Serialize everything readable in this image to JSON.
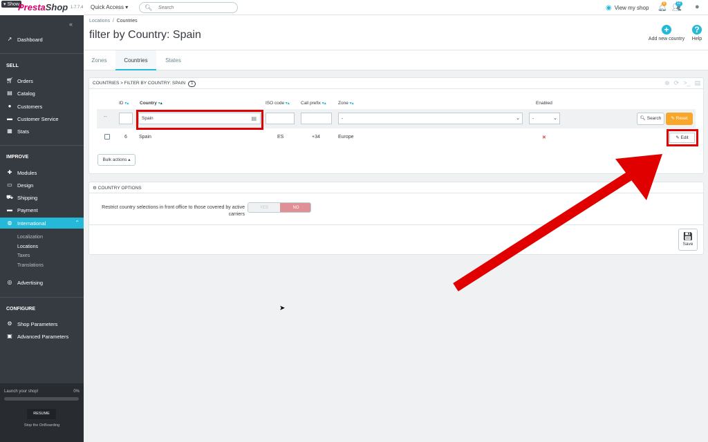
{
  "header": {
    "show_label": "Show",
    "logo_a": "Presta",
    "logo_b": "Shop",
    "version": "1.7.7.4",
    "quick_access": "Quick Access ▾",
    "search_placeholder": "Search",
    "view_shop": "View my shop",
    "notif_orders": "9",
    "notif_customers": "12"
  },
  "sidebar": {
    "dashboard": "Dashboard",
    "sec_sell": "SELL",
    "sell": [
      "Orders",
      "Catalog",
      "Customers",
      "Customer Service",
      "Stats"
    ],
    "sec_improve": "IMPROVE",
    "improve": [
      "Modules",
      "Design",
      "Shipping",
      "Payment",
      "International"
    ],
    "international_sub": [
      "Localization",
      "Locations",
      "Taxes",
      "Translations"
    ],
    "advertising": "Advertising",
    "sec_configure": "CONFIGURE",
    "configure": [
      "Shop Parameters",
      "Advanced Parameters"
    ],
    "launch": "Launch your shop!",
    "progress": "0%",
    "resume": "RESUME",
    "stop": "Stop the OnBoarding"
  },
  "page": {
    "crumb_parent": "Locations",
    "crumb_current": "Countries",
    "title": "filter by Country: Spain",
    "add_country": "Add new country",
    "help": "Help",
    "tabs": [
      "Zones",
      "Countries",
      "States"
    ]
  },
  "list": {
    "title": "COUNTRIES > FILTER BY COUNTRY: SPAIN",
    "count": "1",
    "cols": {
      "id": "ID",
      "country": "Country",
      "iso": "ISO code",
      "prefix": "Call prefix",
      "zone": "Zone",
      "enabled": "Enabled"
    },
    "filter": {
      "dashes": "--",
      "country": "Spain",
      "zone": "-",
      "enabled": "-"
    },
    "search_btn": "Search",
    "reset_btn": "Reset",
    "row": {
      "id": "6",
      "country": "Spain",
      "iso": "ES",
      "prefix": "+34",
      "zone": "Europe",
      "enabled": "✖"
    },
    "edit": "Edit",
    "bulk": "Bulk actions ▴"
  },
  "options": {
    "title": "COUNTRY OPTIONS",
    "label": "Restrict country selections in front office to those covered by active carriers",
    "yes": "YES",
    "no": "NO",
    "save": "Save"
  },
  "colors": {
    "accent": "#25b9d7",
    "annotation": "#e00000",
    "reset": "#f9a72b"
  }
}
